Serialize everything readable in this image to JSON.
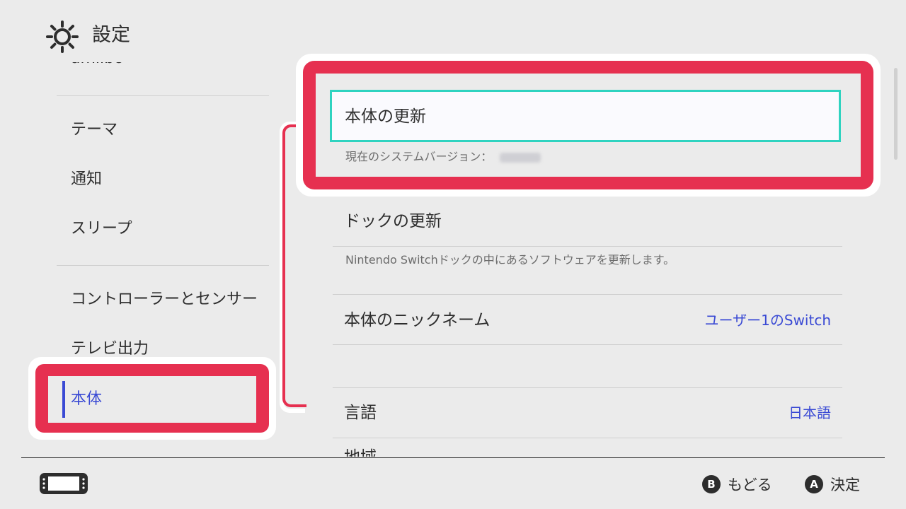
{
  "header": {
    "title": "設定",
    "icon": "gear-icon"
  },
  "sidebar": {
    "cut_item": "amiibo",
    "items": [
      {
        "label": "テーマ"
      },
      {
        "label": "通知"
      },
      {
        "label": "スリープ"
      },
      {
        "label": "コントローラーとセンサー"
      },
      {
        "label": "テレビ出力"
      },
      {
        "label": "本体",
        "selected": true
      }
    ]
  },
  "main": {
    "system_update": {
      "label": "本体の更新",
      "version_label": "現在のシステムバージョン："
    },
    "dock_update": {
      "label": "ドックの更新",
      "description": "Nintendo Switchドックの中にあるソフトウェアを更新します。"
    },
    "nickname": {
      "label": "本体のニックネーム",
      "value": "ユーザー1のSwitch"
    },
    "language": {
      "label": "言語",
      "value": "日本語"
    },
    "next_row_cut": "地域"
  },
  "footer": {
    "console_icon": "console-icon",
    "back": {
      "glyph": "B",
      "label": "もどる"
    },
    "confirm": {
      "glyph": "A",
      "label": "決定"
    }
  },
  "colors": {
    "accent_blue": "#3a4ad4",
    "highlight_red": "#e63050",
    "focus_cyan": "#2fd3c0",
    "background": "#ebebeb"
  }
}
